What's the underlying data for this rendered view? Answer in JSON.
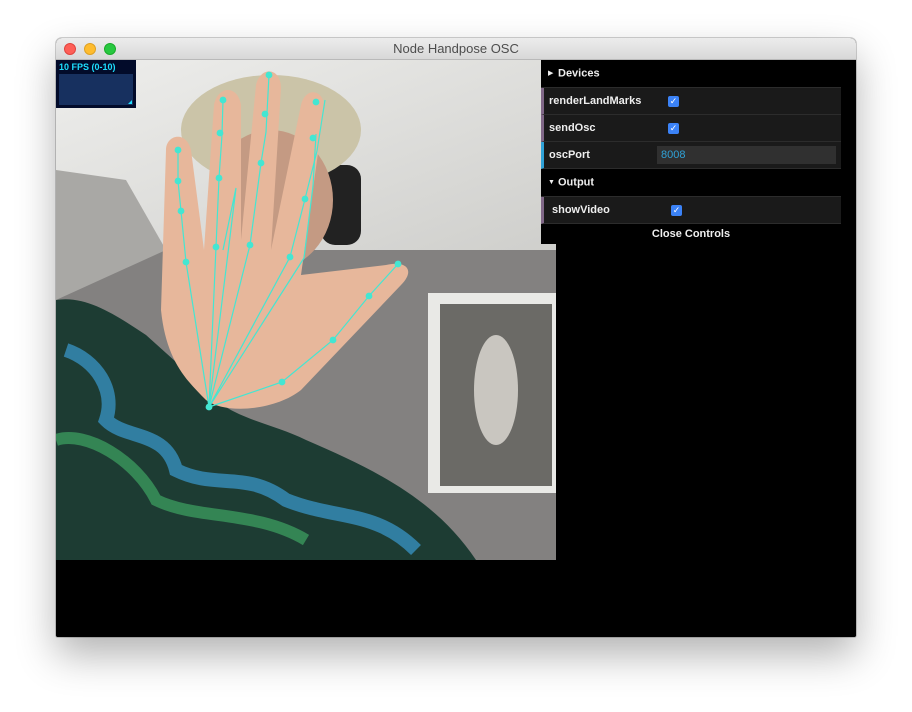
{
  "window": {
    "title": "Node Handpose OSC"
  },
  "stats": {
    "fps_text": "10 FPS (0-10)"
  },
  "gui": {
    "folders": [
      {
        "name": "Devices",
        "expanded": false
      },
      {
        "name": "Output",
        "expanded": true
      }
    ],
    "controls": {
      "renderLandMarks": {
        "label": "renderLandMarks",
        "checked": true
      },
      "sendOsc": {
        "label": "sendOsc",
        "checked": true
      },
      "oscPort": {
        "label": "oscPort",
        "value": "8008"
      },
      "showVideo": {
        "label": "showVideo",
        "checked": true
      }
    },
    "close_label": "Close Controls"
  },
  "colors": {
    "accent_checkbox": "#3b82f6",
    "landmark": "#44e6d2",
    "folder_stripe": "#806787",
    "number_stripe": "#2fa1d6"
  },
  "icons": {
    "devices_toggle": "triangle-right-icon",
    "output_toggle": "triangle-down-icon",
    "checkbox": "checkmark-icon"
  }
}
